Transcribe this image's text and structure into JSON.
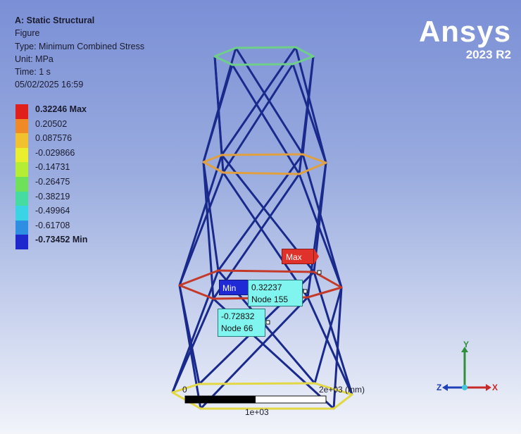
{
  "header": {
    "analysis": "A: Static Structural",
    "object": "Figure",
    "type": "Type: Minimum Combined Stress",
    "unit": "Unit: MPa",
    "time": "Time: 1 s",
    "date": "05/02/2025 16:59"
  },
  "brand": {
    "name": "Ansys",
    "version": "2023 R2"
  },
  "legend": [
    {
      "label": "0.32246 Max",
      "color": "#e0201a",
      "bold": true
    },
    {
      "label": "0.20502",
      "color": "#f08a26",
      "bold": false
    },
    {
      "label": "0.087576",
      "color": "#f2c22e",
      "bold": false
    },
    {
      "label": "-0.029866",
      "color": "#e9ef2e",
      "bold": false
    },
    {
      "label": "-0.14731",
      "color": "#b5ec34",
      "bold": false
    },
    {
      "label": "-0.26475",
      "color": "#6fe05a",
      "bold": false
    },
    {
      "label": "-0.38219",
      "color": "#46dba0",
      "bold": false
    },
    {
      "label": "-0.49964",
      "color": "#3ad4e4",
      "bold": false
    },
    {
      "label": "-0.61708",
      "color": "#2e8fe2",
      "bold": false
    },
    {
      "label": "-0.73452 Min",
      "color": "#1f28cc",
      "bold": true
    }
  ],
  "tags": {
    "max": "Max",
    "min": "Min",
    "probe1_value": "0.32237",
    "probe1_node": "Node 155",
    "probe2_value": "-0.72832",
    "probe2_node": "Node 66"
  },
  "scale": {
    "start": "0",
    "end": "2e+03 (mm)",
    "mid": "1e+03"
  },
  "axes": {
    "x": "X",
    "y": "Y",
    "z": "Z"
  },
  "colors": {
    "member": "#1a2a8c",
    "ring_top": "#6fcf8a",
    "ring_mid": "#e0a040",
    "ring_low": "#c43a2a",
    "ring_base": "#e2d845"
  }
}
